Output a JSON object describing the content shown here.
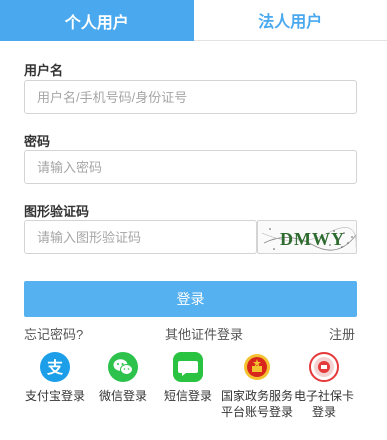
{
  "tabs": {
    "personal": "个人用户",
    "legal": "法人用户"
  },
  "form": {
    "username_label": "用户名",
    "username_placeholder": "用户名/手机号码/身份证号",
    "password_label": "密码",
    "password_placeholder": "请输入密码",
    "captcha_label": "图形验证码",
    "captcha_placeholder": "请输入图形验证码",
    "captcha_text": "DMWY"
  },
  "login_button": "登录",
  "links": {
    "forgot": "忘记密码?",
    "other_cert": "其他证件登录",
    "register": "注册"
  },
  "alt_logins": [
    {
      "label": "支付宝登录",
      "icon": "alipay-icon",
      "color": "#1c9fe8"
    },
    {
      "label": "微信登录",
      "icon": "wechat-icon",
      "color": "#2cc24b"
    },
    {
      "label": "短信登录",
      "icon": "sms-icon",
      "color": "#29c341"
    },
    {
      "label": "国家政务服务平台账号登录",
      "icon": "national-emblem-icon",
      "color": "#d9261c"
    },
    {
      "label": "电子社保卡登录",
      "icon": "social-security-card-icon",
      "color": "#e53a3a"
    }
  ]
}
